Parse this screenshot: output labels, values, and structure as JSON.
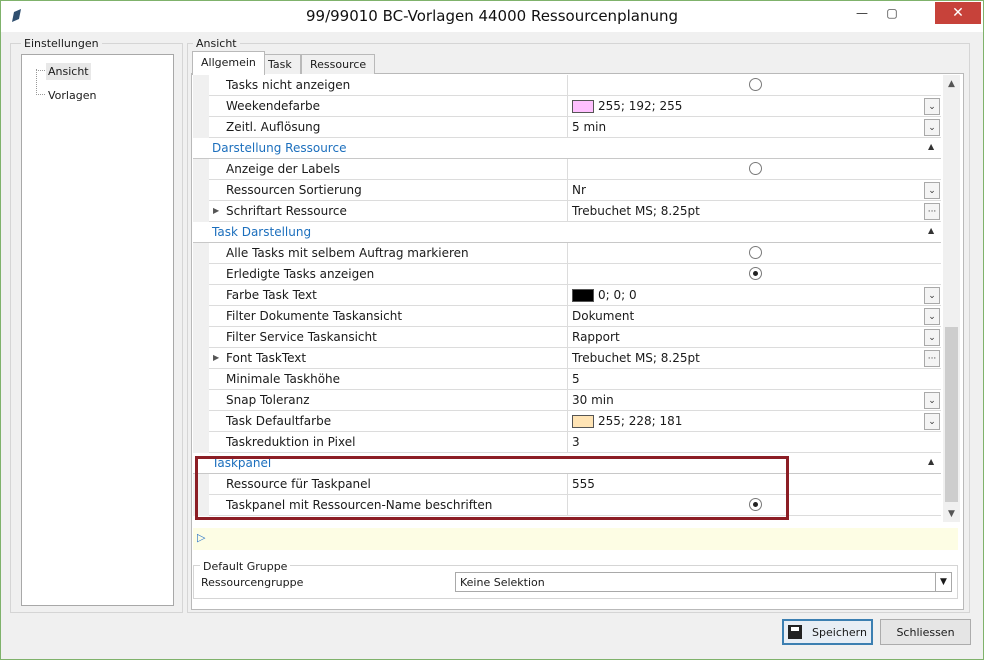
{
  "window": {
    "title": "99/99010 BC-Vorlagen   44000 Ressourcenplanung",
    "minimize_glyph": "—",
    "restore_glyph": "▢",
    "close_glyph": "✕"
  },
  "left_group": {
    "label": "Einstellungen",
    "items": [
      {
        "label": "Ansicht",
        "selected": true
      },
      {
        "label": "Vorlagen",
        "selected": false
      }
    ]
  },
  "right_group": {
    "label": "Ansicht",
    "tabs": [
      {
        "label": "Allgemein",
        "active": true
      },
      {
        "label": "Task",
        "active": false
      },
      {
        "label": "Ressource",
        "active": false
      }
    ]
  },
  "grid": {
    "rows": [
      {
        "type": "property",
        "name": "Tasks nicht anzeigen",
        "editor": "radio",
        "checked": false
      },
      {
        "type": "property",
        "name": "Weekendefarbe",
        "editor": "color",
        "color": "#ffc0ff",
        "value": "255; 192; 255"
      },
      {
        "type": "property",
        "name": "Zeitl. Auflösung",
        "editor": "dropdown",
        "value": "5 min"
      },
      {
        "type": "category",
        "name": "Darstellung Ressource"
      },
      {
        "type": "property",
        "name": "Anzeige der Labels",
        "editor": "radio",
        "checked": false
      },
      {
        "type": "property",
        "name": "Ressourcen Sortierung",
        "editor": "dropdown",
        "value": "Nr"
      },
      {
        "type": "property",
        "name": "Schriftart Ressource",
        "editor": "ellipsis",
        "expandable": true,
        "value": "Trebuchet MS; 8.25pt"
      },
      {
        "type": "category",
        "name": "Task Darstellung"
      },
      {
        "type": "property",
        "name": "Alle Tasks mit selbem Auftrag markieren",
        "editor": "radio",
        "checked": false
      },
      {
        "type": "property",
        "name": "Erledigte Tasks anzeigen",
        "editor": "radio",
        "checked": true
      },
      {
        "type": "property",
        "name": "Farbe Task Text",
        "editor": "color",
        "color": "#000000",
        "value": "0; 0; 0"
      },
      {
        "type": "property",
        "name": "Filter Dokumente Taskansicht",
        "editor": "dropdown",
        "value": "Dokument"
      },
      {
        "type": "property",
        "name": "Filter Service Taskansicht",
        "editor": "dropdown",
        "value": "Rapport"
      },
      {
        "type": "property",
        "name": "Font TaskText",
        "editor": "ellipsis",
        "expandable": true,
        "value": "Trebuchet MS; 8.25pt"
      },
      {
        "type": "property",
        "name": "Minimale Taskhöhe",
        "editor": "text",
        "value": "5"
      },
      {
        "type": "property",
        "name": "Snap Toleranz",
        "editor": "dropdown",
        "value": "30 min"
      },
      {
        "type": "property",
        "name": "Task Defaultfarbe",
        "editor": "color",
        "color": "#ffe4b5",
        "value": "255; 228; 181"
      },
      {
        "type": "property",
        "name": "Taskreduktion in Pixel",
        "editor": "text",
        "value": "3"
      },
      {
        "type": "category",
        "name": "Taskpanel"
      },
      {
        "type": "property",
        "name": "Ressource für Taskpanel",
        "editor": "text",
        "value": "555"
      },
      {
        "type": "property",
        "name": "Taskpanel mit Ressourcen-Name beschriften",
        "editor": "radio",
        "checked": true
      }
    ]
  },
  "default_group": {
    "label": "Default Gruppe",
    "field_label": "Ressourcengruppe",
    "selected_value": "Keine Selektion"
  },
  "buttons": {
    "save_label": "Speichern",
    "close_label": "Schliessen"
  },
  "colors": {
    "category_text": "#1c6fbd",
    "highlight_border": "#8c1e25",
    "close_button": "#c7423a"
  }
}
